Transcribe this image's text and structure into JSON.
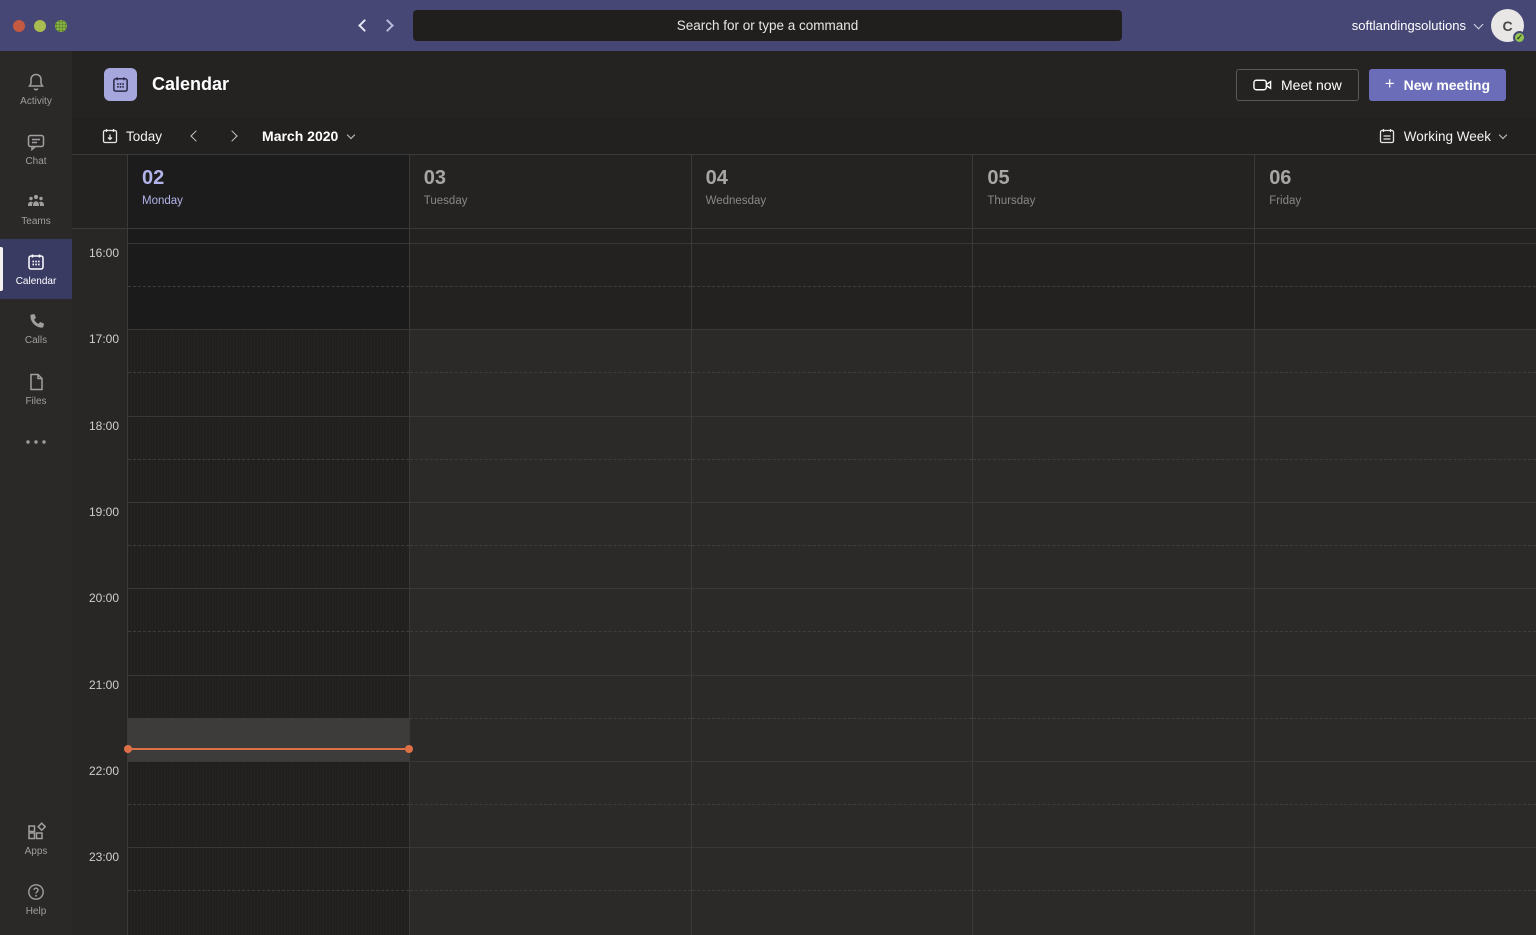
{
  "window": {
    "controls": [
      "close",
      "minimize",
      "zoom"
    ]
  },
  "topbar": {
    "search_placeholder": "Search for or type a command",
    "account_name": "softlandingsolutions",
    "avatar_initial": "C",
    "presence_status": "available"
  },
  "sidebar": {
    "items": [
      {
        "id": "activity",
        "label": "Activity",
        "icon": "bell-icon",
        "selected": false
      },
      {
        "id": "chat",
        "label": "Chat",
        "icon": "chat-icon",
        "selected": false
      },
      {
        "id": "teams",
        "label": "Teams",
        "icon": "teams-icon",
        "selected": false
      },
      {
        "id": "calendar",
        "label": "Calendar",
        "icon": "calendar-icon",
        "selected": true
      },
      {
        "id": "calls",
        "label": "Calls",
        "icon": "phone-icon",
        "selected": false
      },
      {
        "id": "files",
        "label": "Files",
        "icon": "file-icon",
        "selected": false
      },
      {
        "id": "more",
        "label": "",
        "icon": "ellipsis-icon",
        "selected": false
      }
    ],
    "bottom_items": [
      {
        "id": "apps",
        "label": "Apps",
        "icon": "apps-icon"
      },
      {
        "id": "help",
        "label": "Help",
        "icon": "help-icon"
      }
    ]
  },
  "header": {
    "title": "Calendar",
    "meet_now_label": "Meet now",
    "new_meeting_label": "New meeting"
  },
  "toolbar": {
    "today_label": "Today",
    "month_label": "March 2020",
    "view_label": "Working Week"
  },
  "calendar": {
    "days": [
      {
        "number": "02",
        "name": "Monday",
        "is_today": true
      },
      {
        "number": "03",
        "name": "Tuesday",
        "is_today": false
      },
      {
        "number": "04",
        "name": "Wednesday",
        "is_today": false
      },
      {
        "number": "05",
        "name": "Thursday",
        "is_today": false
      },
      {
        "number": "06",
        "name": "Friday",
        "is_today": false
      }
    ],
    "times": [
      "16:00",
      "17:00",
      "18:00",
      "19:00",
      "20:00",
      "21:00",
      "22:00",
      "23:00"
    ],
    "working_hours_end": "17:00",
    "current_time": "21:51",
    "highlighted_slot_start": "21:30",
    "highlighted_slot_minutes": 30
  },
  "colors": {
    "brand_purple": "#464775",
    "button_purple": "#6b6db8",
    "today_accent": "#b2b3ea",
    "now_indicator": "#dd7047",
    "presence_green": "#92c353"
  }
}
